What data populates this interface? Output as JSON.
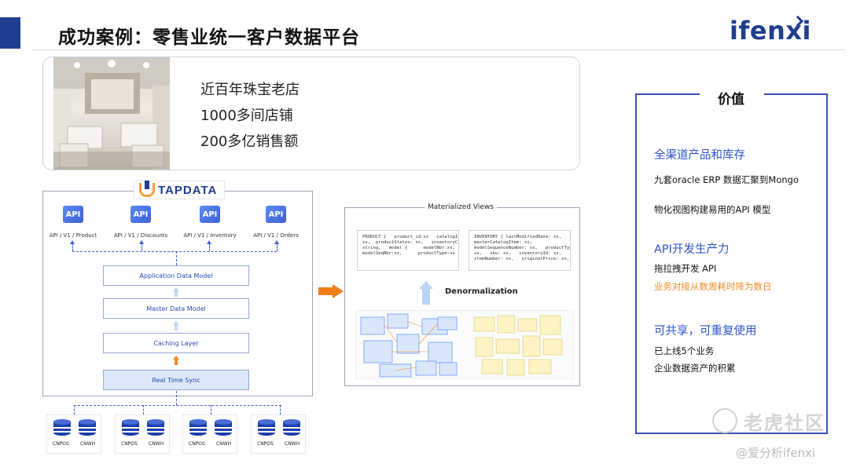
{
  "header": {
    "title": "成功案例：零售业统一客户数据平台",
    "brand": "ifenxi"
  },
  "case_card": {
    "facts": [
      "近百年珠宝老店",
      "1000多间店铺",
      "200多亿销售额"
    ]
  },
  "architecture": {
    "badge": "TAPDATA",
    "apis": [
      {
        "icon": "API",
        "caption": "API / V1 / Product"
      },
      {
        "icon": "API",
        "caption": "API / V1 / Discounts"
      },
      {
        "icon": "API",
        "caption": "API / V1 / Inventory"
      },
      {
        "icon": "API",
        "caption": "API / V1 / Orders"
      }
    ],
    "layers": [
      "Application Data Model",
      "Master Data Model",
      "Caching Layer",
      "Real Time Sync"
    ],
    "db_groups": [
      {
        "left": "CNPOS",
        "right": "CNWH"
      },
      {
        "left": "CNPOS",
        "right": "CNWH"
      },
      {
        "left": "CNPOS",
        "right": "CNWH"
      },
      {
        "left": "CNPOS",
        "right": "CNWH"
      }
    ]
  },
  "materialized": {
    "title": "Materialized Views",
    "product_code": "PRODUCT {   product_id:xx   catalogItem:\nxx,  productStatus: xx,   inventoryClass:\nstring,   model {      modelNbr:xx,\nmodelSeqNbr:xx,      productType:xx  } }",
    "inventory_code": "INVENTORY { lastModifiedDate: xx,\nmasterCatalogItem: xx,\nmodelSequenceNumber: xx,   productType:\nxx,   sku: xx,   inventoryId: xx,\nitemNumber: xx,   originalPrice: xx, } }",
    "denorm_label": "Denormalization"
  },
  "value": {
    "title": "价值",
    "sections": [
      {
        "heading": "全渠道产品和库存",
        "lines": [
          "九套oracle ERP 数据汇聚到Mongo",
          "物化视图构建易用的API 模型"
        ]
      },
      {
        "heading": "API开发生产力",
        "lines": [
          "拖拉拽开发 API",
          "业务对接从数周耗时降为数日"
        ]
      },
      {
        "heading": "可共享，可重复使用",
        "lines": [
          "已上线5个业务",
          "企业数据资产的积累"
        ]
      }
    ]
  },
  "watermark": {
    "main": "老虎社区",
    "credit": "@爱分析ifenxi"
  },
  "colors": {
    "brand_blue": "#1f3e8f",
    "accent_blue": "#2d52c8",
    "orange": "#f08a2a"
  }
}
